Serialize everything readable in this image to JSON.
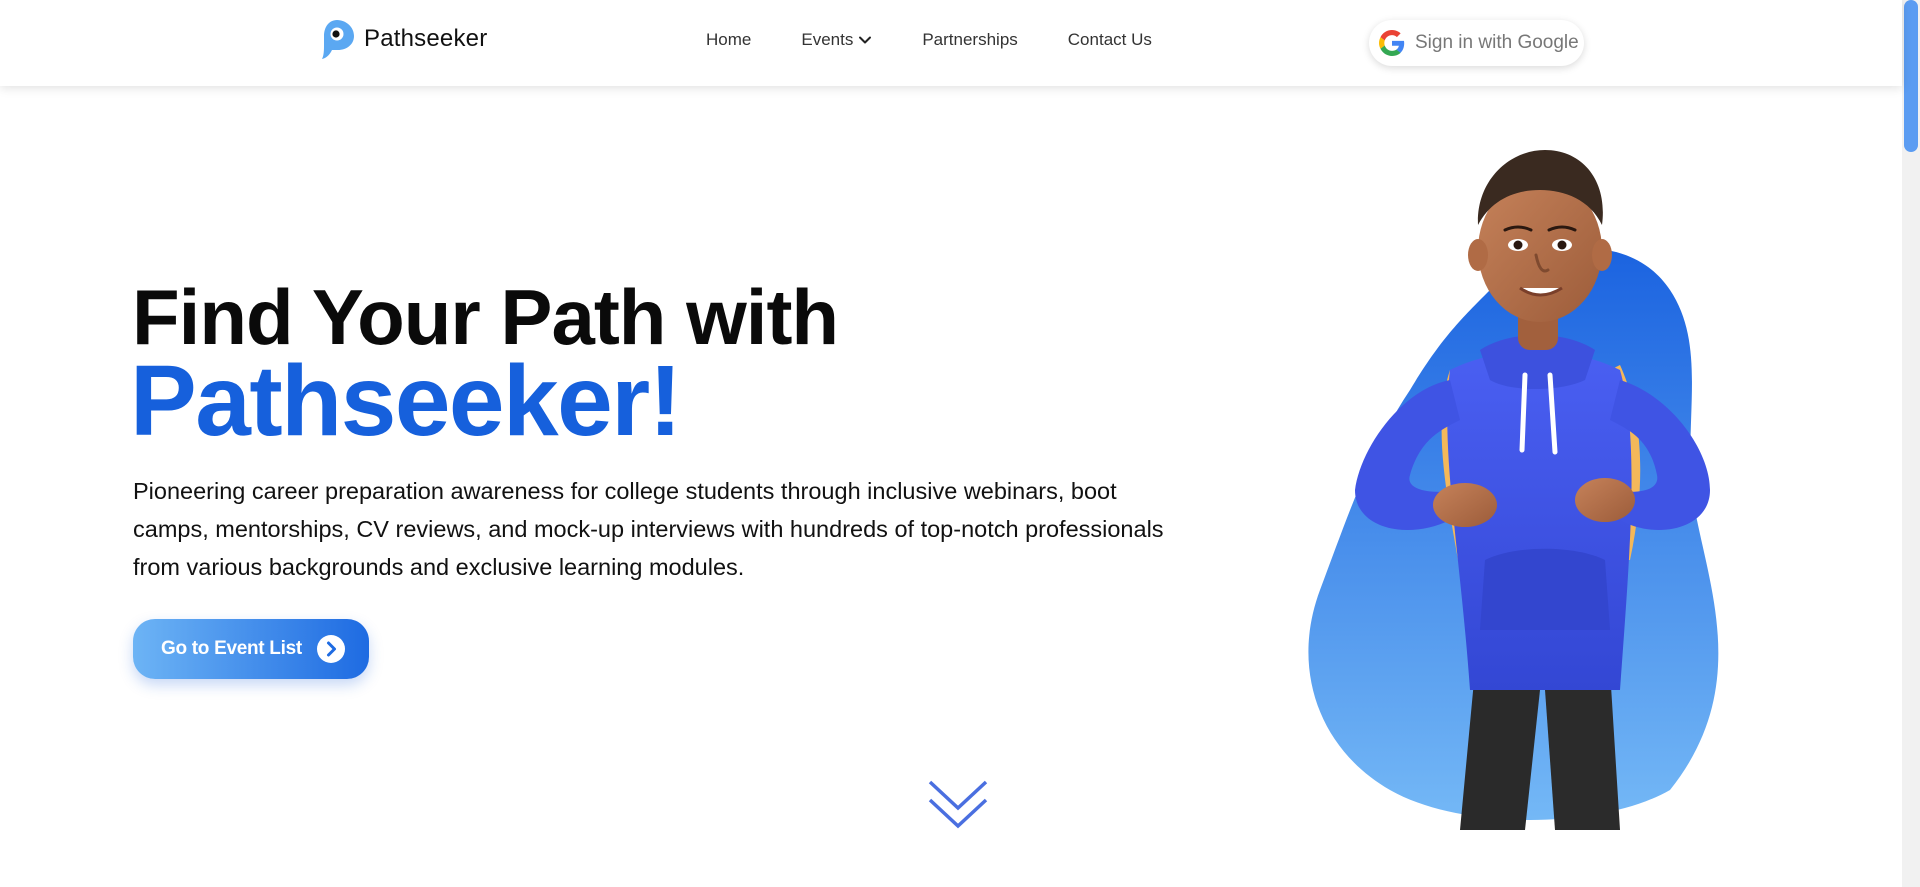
{
  "brand": {
    "name": "Pathseeker",
    "logo_icon": "pathseeker-pin-logo"
  },
  "nav": {
    "items": [
      {
        "label": "Home"
      },
      {
        "label": "Events",
        "icon": "chevron-down-icon"
      },
      {
        "label": "Partnerships"
      },
      {
        "label": "Contact Us"
      }
    ]
  },
  "auth": {
    "google_label": "Sign in with Google",
    "icon": "google-icon"
  },
  "hero": {
    "title_line1": "Find Your Path with",
    "title_line2": "Pathseeker!",
    "description": "Pioneering career preparation awareness for college students through inclusive webinars, boot camps, mentorships, CV reviews, and mock-up interviews with hundreds of top-notch professionals from various backgrounds and exclusive learning modules.",
    "cta_label": "Go to Event List",
    "cta_icon": "chevron-right-circle-icon",
    "scroll_icon": "double-chevron-down-icon"
  },
  "colors": {
    "accent": "#1660dc",
    "cta_gradient_start": "#6db4f5",
    "cta_gradient_end": "#1e6be2",
    "blob_top": "#1b63e0",
    "blob_bottom": "#74b8f6"
  }
}
